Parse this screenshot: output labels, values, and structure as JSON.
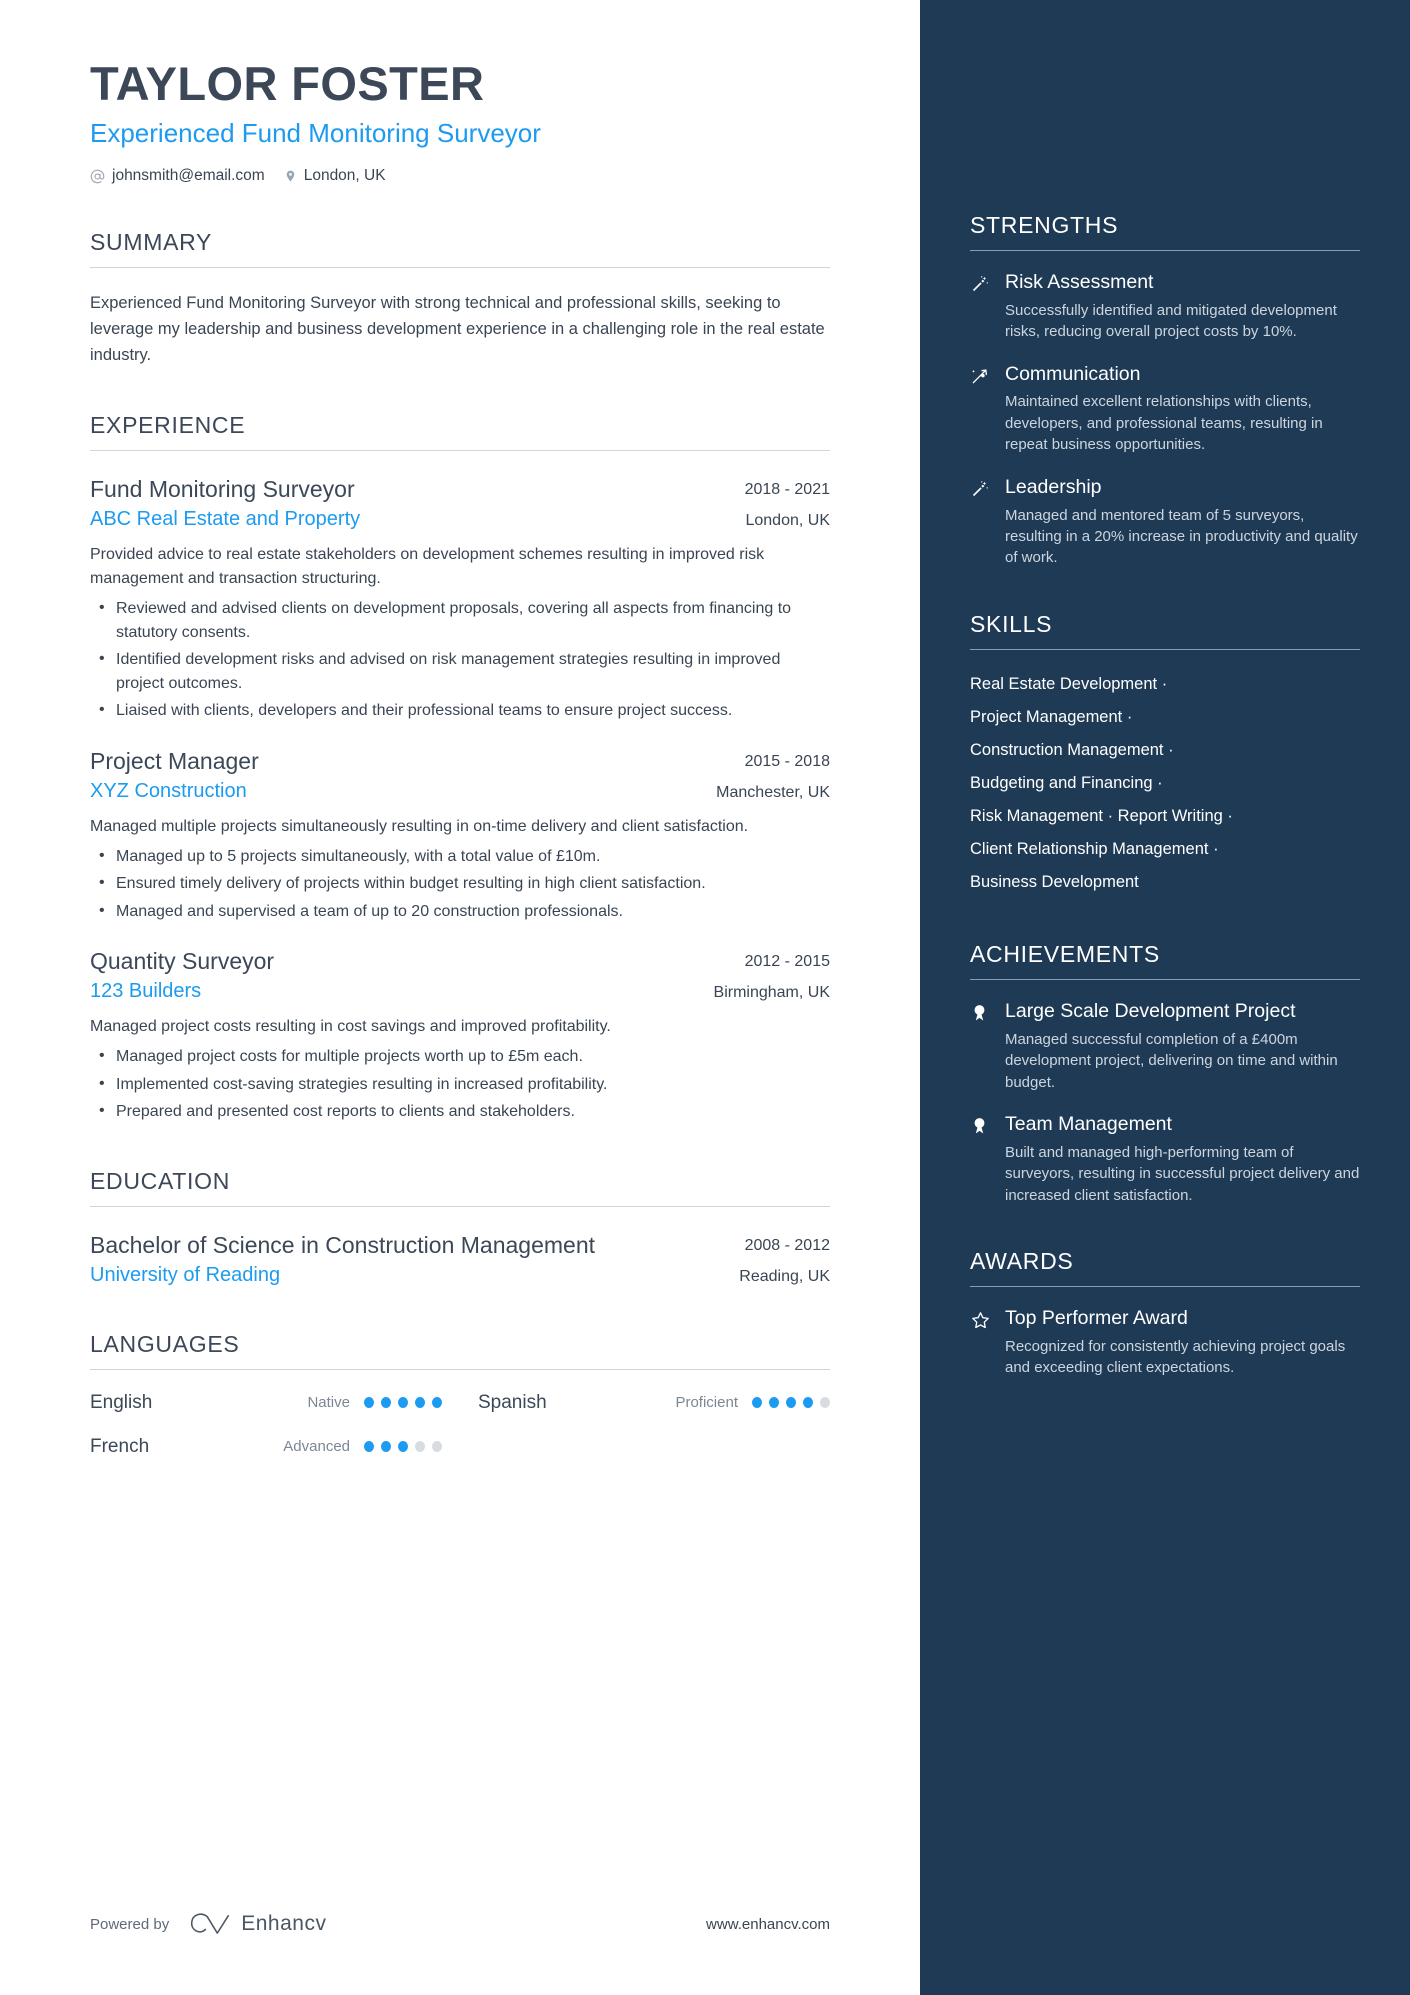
{
  "header": {
    "name": "TAYLOR FOSTER",
    "job_title": "Experienced Fund Monitoring Surveyor",
    "email": "johnsmith@email.com",
    "location": "London, UK",
    "email_icon": "at-sign-icon",
    "location_icon": "map-pin-icon"
  },
  "summary": {
    "title": "SUMMARY",
    "text": "Experienced Fund Monitoring Surveyor with strong technical and professional skills, seeking to leverage my leadership and business development experience in a challenging role in the real estate industry."
  },
  "experience": {
    "title": "EXPERIENCE",
    "entries": [
      {
        "role": "Fund Monitoring Surveyor",
        "date": "2018 - 2021",
        "org": "ABC Real Estate and Property",
        "location": "London, UK",
        "description": "Provided advice to real estate stakeholders on development schemes resulting in improved risk management and transaction structuring.",
        "bullets": [
          "Reviewed and advised clients on development proposals, covering all aspects from financing to statutory consents.",
          "Identified development risks and advised on risk management strategies resulting in improved project outcomes.",
          "Liaised with clients, developers and their professional teams to ensure project success."
        ]
      },
      {
        "role": "Project Manager",
        "date": "2015 - 2018",
        "org": "XYZ Construction",
        "location": "Manchester, UK",
        "description": "Managed multiple projects simultaneously resulting in on-time delivery and client satisfaction.",
        "bullets": [
          "Managed up to 5 projects simultaneously, with a total value of £10m.",
          "Ensured timely delivery of projects within budget resulting in high client satisfaction.",
          "Managed and supervised a team of up to 20 construction professionals."
        ]
      },
      {
        "role": "Quantity Surveyor",
        "date": "2012 - 2015",
        "org": "123 Builders",
        "location": "Birmingham, UK",
        "description": "Managed project costs resulting in cost savings and improved profitability.",
        "bullets": [
          "Managed project costs for multiple projects worth up to £5m each.",
          "Implemented cost-saving strategies resulting in increased profitability.",
          "Prepared and presented cost reports to clients and stakeholders."
        ]
      }
    ]
  },
  "education": {
    "title": "EDUCATION",
    "entries": [
      {
        "degree": "Bachelor of Science in Construction Management",
        "date": "2008 - 2012",
        "school": "University of Reading",
        "location": "Reading, UK"
      }
    ]
  },
  "languages": {
    "title": "LANGUAGES",
    "items": [
      {
        "name": "English",
        "level": "Native",
        "filled": 5,
        "total": 5
      },
      {
        "name": "Spanish",
        "level": "Proficient",
        "filled": 4,
        "total": 5
      },
      {
        "name": "French",
        "level": "Advanced",
        "filled": 3,
        "total": 5
      }
    ]
  },
  "footer": {
    "powered_by": "Powered by",
    "brand": "Enhancv",
    "brand_icon": "enhancv-logo-icon",
    "website": "www.enhancv.com"
  },
  "strengths": {
    "title": "STRENGTHS",
    "entries": [
      {
        "icon": "magic-wand-icon",
        "title": "Risk Assessment",
        "description": "Successfully identified and mitigated development risks, reducing overall project costs by 10%."
      },
      {
        "icon": "shooting-star-icon",
        "title": "Communication",
        "description": "Maintained excellent relationships with clients, developers, and professional teams, resulting in repeat business opportunities."
      },
      {
        "icon": "magic-wand-icon",
        "title": "Leadership",
        "description": "Managed and mentored team of 5 surveyors, resulting in a 20% increase in productivity and quality of work."
      }
    ]
  },
  "skills": {
    "title": "SKILLS",
    "separator": "·",
    "lines": [
      [
        "Real Estate Development"
      ],
      [
        "Project Management"
      ],
      [
        "Construction Management"
      ],
      [
        "Budgeting and Financing"
      ],
      [
        "Risk Management",
        "Report Writing"
      ],
      [
        "Client Relationship Management"
      ],
      [
        "Business Development"
      ]
    ]
  },
  "achievements": {
    "title": "ACHIEVEMENTS",
    "entries": [
      {
        "icon": "award-medal-icon",
        "title": "Large Scale Development Project",
        "description": "Managed successful completion of a £400m development project, delivering on time and within budget."
      },
      {
        "icon": "award-medal-icon",
        "title": "Team Management",
        "description": "Built and managed high-performing team of surveyors, resulting in successful project delivery and increased client satisfaction."
      }
    ]
  },
  "awards": {
    "title": "AWARDS",
    "entries": [
      {
        "icon": "star-outline-icon",
        "title": "Top Performer Award",
        "description": "Recognized for consistently achieving project goals and exceeding client expectations."
      }
    ]
  },
  "colors": {
    "accent": "#1c9bf0",
    "sidebar_bg": "#1f3a55",
    "text": "#3a4553"
  }
}
